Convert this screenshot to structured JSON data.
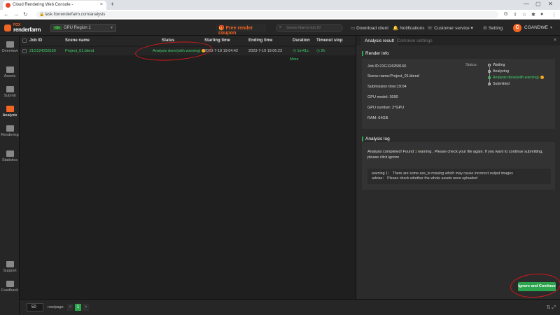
{
  "browser": {
    "tab_title": "Cloud Rendering Web Console -",
    "url": "task.foxrenderfarm.com/analysis"
  },
  "topbar": {
    "logo_top": "FOX",
    "logo_bottom": "renderfarm",
    "region_tag": "Idle",
    "region_name": "GPU Region 1",
    "coupon": "Free render coupon",
    "search_placeholder": "Scene Name/Job ID",
    "download_client": "Download client",
    "notifications": "Notifications",
    "customer_service": "Customer service",
    "setting": "Setting",
    "avatar_letter": "C",
    "username": "CGANDWE"
  },
  "sidebar": {
    "items": [
      {
        "label": "Overview"
      },
      {
        "label": "Assets"
      },
      {
        "label": "Submit"
      },
      {
        "label": "Analysis"
      },
      {
        "label": "Rendering"
      },
      {
        "label": "Statistics"
      },
      {
        "label": "Support"
      },
      {
        "label": "Feedback"
      }
    ]
  },
  "table": {
    "headers": [
      "Job ID",
      "Scene name",
      "Status",
      "Starting time",
      "Ending time",
      "Duration",
      "Timeout stop"
    ],
    "rows": [
      {
        "job_id": "21G124258160",
        "scene": "Project_01.blend",
        "status": "Analysis done(with warning)",
        "start": "2023-7-19 19:04:42",
        "end": "2023-7-19 19:06:23",
        "duration": "1m41s",
        "timeout": "2h"
      }
    ],
    "more": "More"
  },
  "footer": {
    "page_size": "50",
    "row_page": "row/page",
    "current_page": "1",
    "prev": "<",
    "next": ">"
  },
  "panel": {
    "tab_active": "Analysis result",
    "tab_inactive": "Common settings",
    "render_info_title": "Render info",
    "info": {
      "job_id": "Job ID:21G124258160",
      "scene": "Scene name:Project_01.blend",
      "submission": "Submission time:19:04",
      "gpu_model": "GPU model:  3090",
      "gpu_number": "GPU number:  2*GPU",
      "ram": "RAM:  64GB"
    },
    "status_label": "Status:",
    "steps": [
      "Waiting",
      "Analyzing",
      "Analysis done(with warning)",
      "Submitted"
    ],
    "analysis_log_title": "Analysis log",
    "log_prefix": "Analysis completed! Found",
    "log_count": "1",
    "log_suffix": "warning  , Please check your file again. If you want to continue submitting, please click ignore",
    "log_warning": "warning 1： There are some ass_ts missing which may cause incorrect output images",
    "log_advise": "advise： Please check whether the whole assets were uploaded",
    "ignore_button": "Ignore and Continue"
  },
  "colors": {
    "accent_green": "#2da44e",
    "brand_orange": "#f26522",
    "warning": "#f5a623",
    "annotation_red": "#d01818"
  }
}
